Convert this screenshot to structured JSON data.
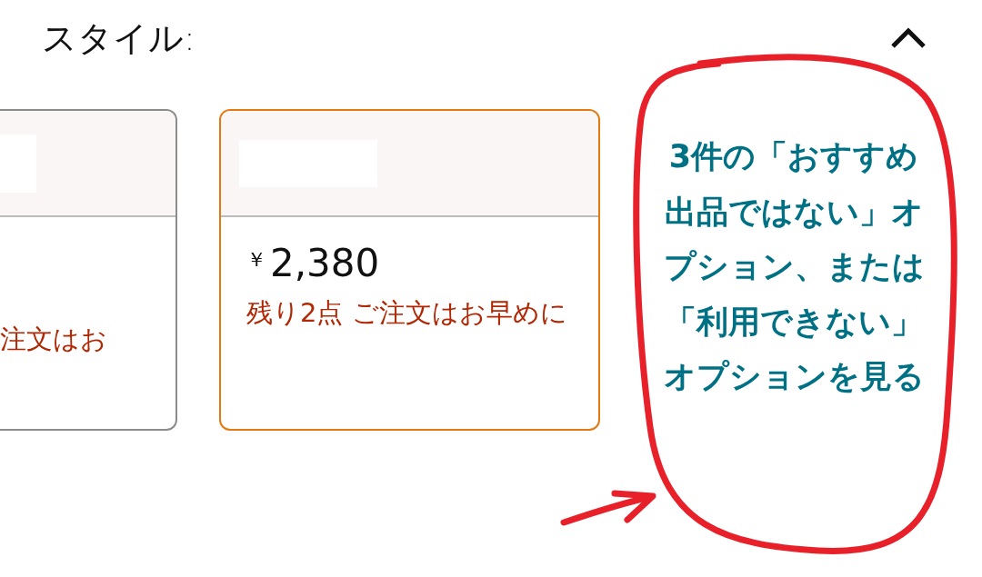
{
  "header": {
    "title": "スタイル:"
  },
  "options": [
    {
      "stock_note": "注文はお",
      "selected": false
    },
    {
      "price_symbol": "￥",
      "price": "2,380",
      "stock_note": "残り2点 ご注文はお早めに",
      "selected": true
    }
  ],
  "more_options_link": "3件の「おすすめ出品ではない」オプション、または「利用できない」オプションを見る"
}
